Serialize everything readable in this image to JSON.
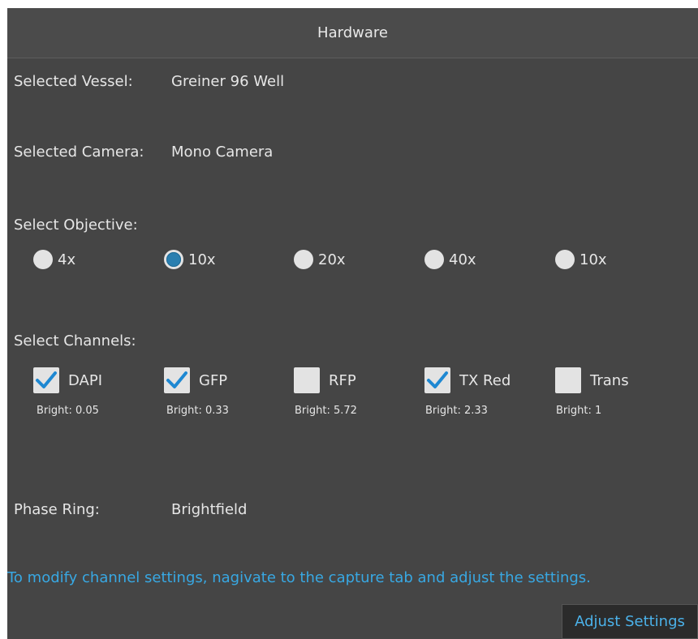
{
  "title": "Hardware",
  "vessel": {
    "label": "Selected Vessel:",
    "value": "Greiner 96 Well"
  },
  "camera": {
    "label": "Selected Camera:",
    "value": "Mono Camera"
  },
  "objective": {
    "label": "Select Objective:",
    "options": [
      {
        "label": "4x",
        "selected": false
      },
      {
        "label": "10x",
        "selected": true
      },
      {
        "label": "20x",
        "selected": false
      },
      {
        "label": "40x",
        "selected": false
      },
      {
        "label": "10x",
        "selected": false
      }
    ]
  },
  "channels": {
    "label": "Select Channels:",
    "items": [
      {
        "label": "DAPI",
        "checked": true,
        "bright": "Bright: 0.05"
      },
      {
        "label": "GFP",
        "checked": true,
        "bright": "Bright: 0.33"
      },
      {
        "label": "RFP",
        "checked": false,
        "bright": "Bright: 5.72"
      },
      {
        "label": "TX Red",
        "checked": true,
        "bright": "Bright: 2.33"
      },
      {
        "label": "Trans",
        "checked": false,
        "bright": "Bright: 1"
      }
    ]
  },
  "phase_ring": {
    "label": "Phase Ring:",
    "value": "Brightfield"
  },
  "info_text": "To modify channel settings, nagivate to the capture tab and adjust the settings.",
  "adjust_button": "Adjust Settings",
  "colors": {
    "panel_bg": "#454545",
    "accent": "#38a8e3",
    "radio_selected": "#2a7fb0",
    "check_mark": "#1e88d2"
  }
}
